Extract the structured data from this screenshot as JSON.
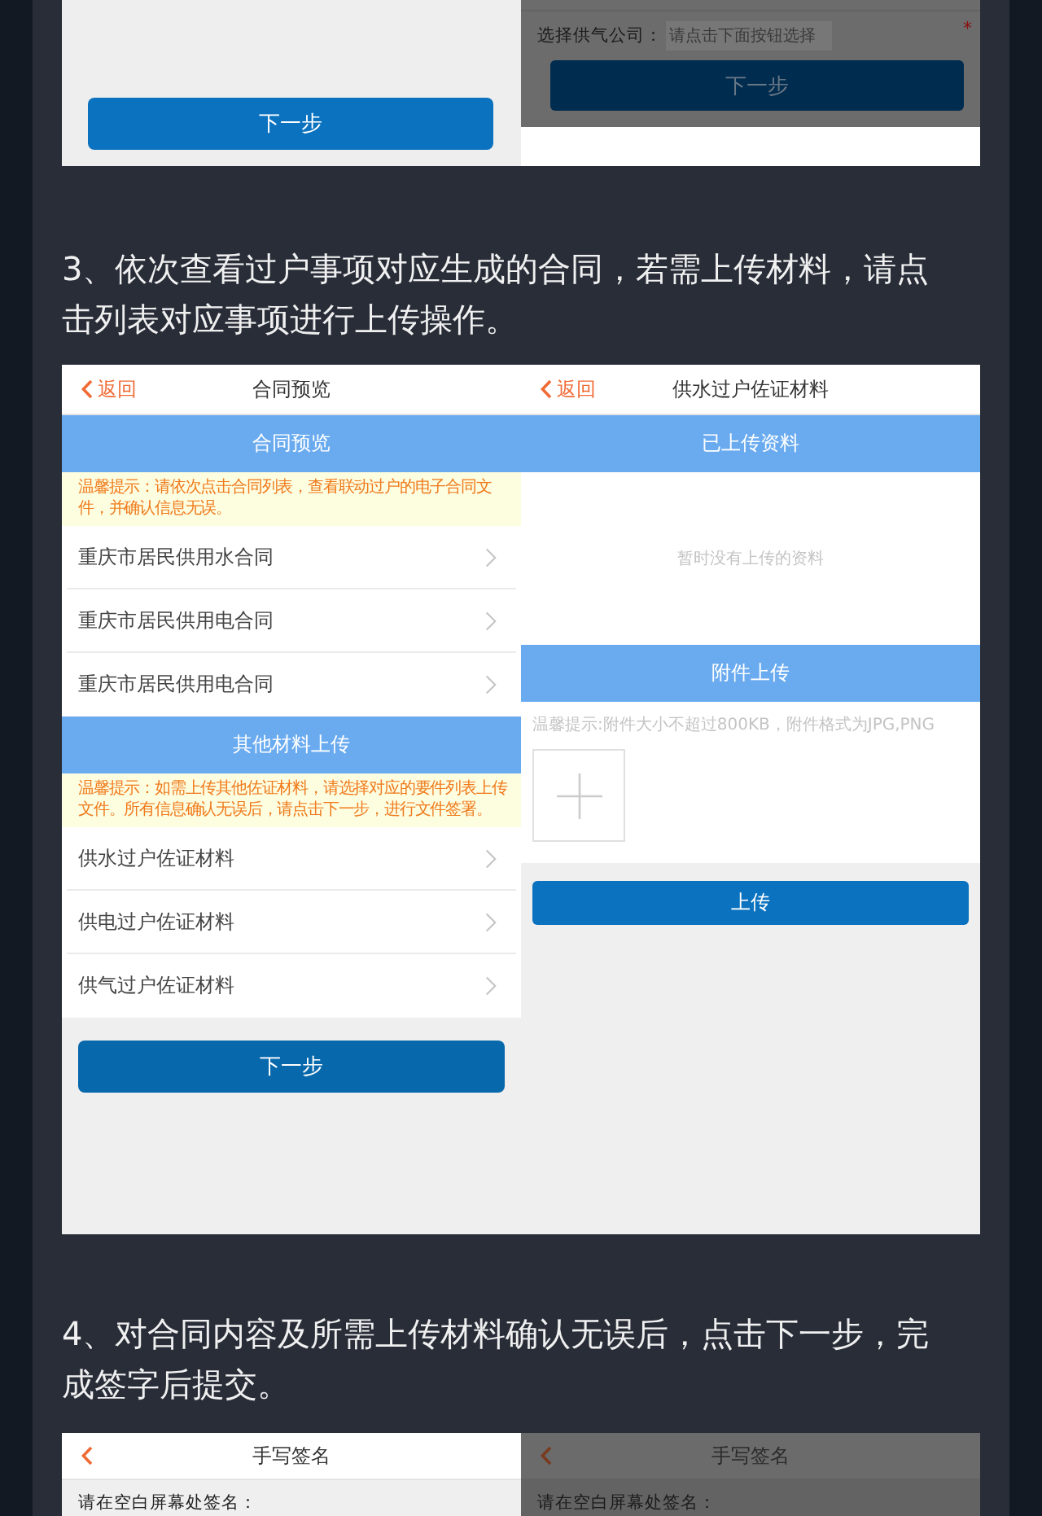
{
  "step2_screens": {
    "left": {
      "button": "下一步"
    },
    "right": {
      "dimmed": true,
      "field_label": "选择供气公司：",
      "placeholder": "请点击下面按钮选择",
      "required_mark": "*",
      "button": "下一步"
    }
  },
  "step3": {
    "text": "3、依次查看过户事项对应生成的合同，若需上传材料，请点击列表对应事项进行上传操作。",
    "contract_screen": {
      "back": "返回",
      "title": "合同预览",
      "sections": [
        {
          "heading": "合同预览",
          "tip": "温馨提示：请依次点击合同列表，查看联动过户的电子合同文件，并确认信息无误。",
          "items": [
            "重庆市居民供用水合同",
            "重庆市居民供用电合同",
            "重庆市居民供用电合同"
          ]
        },
        {
          "heading": "其他材料上传",
          "tip": "温馨提示：如需上传其他佐证材料，请选择对应的要件列表上传文件。所有信息确认无误后，请点击下一步，进行文件签署。",
          "items": [
            "供水过户佐证材料",
            "供电过户佐证材料",
            "供气过户佐证材料"
          ]
        }
      ],
      "button": "下一步"
    },
    "upload_screen": {
      "back": "返回",
      "title": "供水过户佐证材料",
      "uploaded_heading": "已上传资料",
      "empty_text": "暂时没有上传的资料",
      "attach_heading": "附件上传",
      "hint": "温馨提示:附件大小不超过800KB，附件格式为JPG,PNG",
      "button": "上传"
    }
  },
  "step4": {
    "text": "4、对合同内容及所需上传材料确认无误后，点击下一步，完成签字后提交。",
    "screens": [
      {
        "title": "手写签名",
        "prompt": "请在空白屏幕处签名：",
        "dimmed": false
      },
      {
        "title": "手写签名",
        "prompt": "请在空白屏幕处签名：",
        "dimmed": true
      }
    ]
  }
}
